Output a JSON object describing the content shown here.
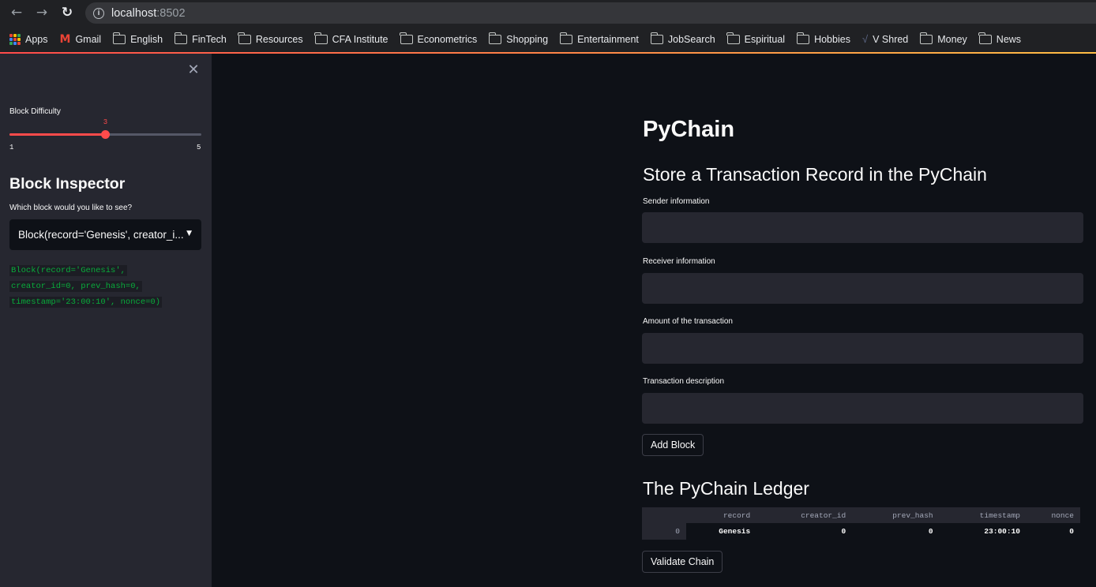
{
  "browser": {
    "url_host": "localhost",
    "url_port": ":8502",
    "bookmarks": [
      {
        "label": "Apps",
        "icon": "apps-grid-icon"
      },
      {
        "label": "Gmail",
        "icon": "gmail-icon"
      },
      {
        "label": "English",
        "icon": "folder-icon"
      },
      {
        "label": "FinTech",
        "icon": "folder-icon"
      },
      {
        "label": "Resources",
        "icon": "folder-icon"
      },
      {
        "label": "CFA Institute",
        "icon": "folder-icon"
      },
      {
        "label": "Econometrics",
        "icon": "folder-icon"
      },
      {
        "label": "Shopping",
        "icon": "folder-icon"
      },
      {
        "label": "Entertainment",
        "icon": "folder-icon"
      },
      {
        "label": "JobSearch",
        "icon": "folder-icon"
      },
      {
        "label": "Espiritual",
        "icon": "folder-icon"
      },
      {
        "label": "Hobbies",
        "icon": "folder-icon"
      },
      {
        "label": "V Shred",
        "icon": "vshred-icon"
      },
      {
        "label": "Money",
        "icon": "folder-icon"
      },
      {
        "label": "News",
        "icon": "folder-icon"
      }
    ]
  },
  "sidebar": {
    "difficulty_label": "Block Difficulty",
    "slider": {
      "value": "3",
      "min": "1",
      "max": "5",
      "fraction": 0.5
    },
    "inspector_heading": "Block Inspector",
    "select_label": "Which block would you like to see?",
    "select_value": "Block(record='Genesis', creator_i...",
    "code_lines": [
      "Block(record='Genesis',",
      "creator_id=0, prev_hash=0,",
      "timestamp='23:00:10', nonce=0)"
    ]
  },
  "main": {
    "title": "PyChain",
    "subtitle": "Store a Transaction Record in the PyChain",
    "fields": [
      {
        "label": "Sender information",
        "value": ""
      },
      {
        "label": "Receiver information",
        "value": ""
      },
      {
        "label": "Amount of the transaction",
        "value": ""
      },
      {
        "label": "Transaction description",
        "value": ""
      }
    ],
    "add_block_label": "Add Block",
    "ledger_title": "The PyChain Ledger",
    "ledger_columns": [
      "record",
      "creator_id",
      "prev_hash",
      "timestamp",
      "nonce"
    ],
    "ledger_rows": [
      {
        "index": "0",
        "cells": [
          "Genesis",
          "0",
          "0",
          "23:00:10",
          "0"
        ]
      }
    ],
    "validate_label": "Validate Chain"
  },
  "colors": {
    "accent": "#ff4b4b",
    "background": "#0e1117",
    "sidebar": "#262730",
    "code_text": "#09ab3b"
  }
}
